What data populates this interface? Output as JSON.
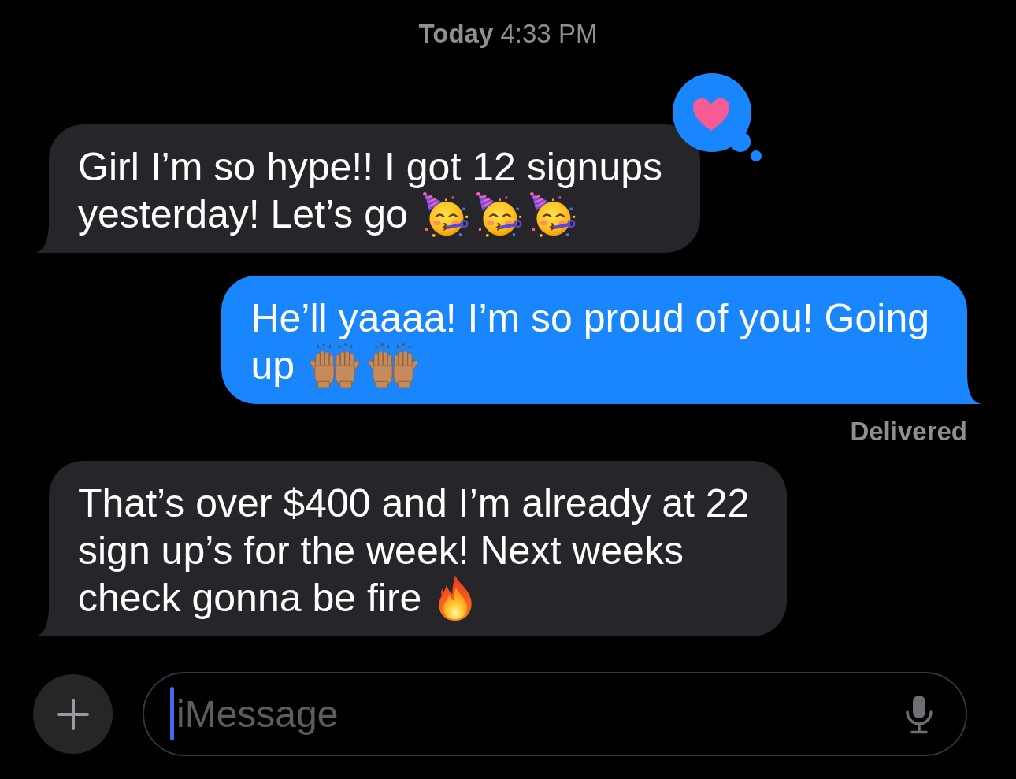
{
  "timestamp": "**Today** 4:33 PM",
  "messages": [
    {
      "from_me": false,
      "lines": [
        "Girl I’m so hype!! I got 12 signups",
        "yesterday! Let’s go"
      ],
      "emojis": [
        {
          "kind": "party_face"
        },
        {
          "kind": "party_face"
        },
        {
          "kind": "party_face"
        }
      ],
      "reaction": {
        "kind": "heart"
      }
    },
    {
      "from_me": true,
      "lines": [
        "He’ll yaaaa! I’m so proud of you! Going",
        "up"
      ],
      "emojis": [
        {
          "kind": "raised_hands"
        },
        {
          "kind": "raised_hands"
        }
      ],
      "status": "Delivered"
    },
    {
      "from_me": false,
      "lines": [
        "That’s over $400 and I’m already at 22",
        "sign up’s for the week! Next weeks",
        "check gonna be fire"
      ],
      "emojis": [
        {
          "kind": "fire"
        }
      ]
    }
  ],
  "composer": {
    "placeholder": "iMessage",
    "focused": true
  }
}
